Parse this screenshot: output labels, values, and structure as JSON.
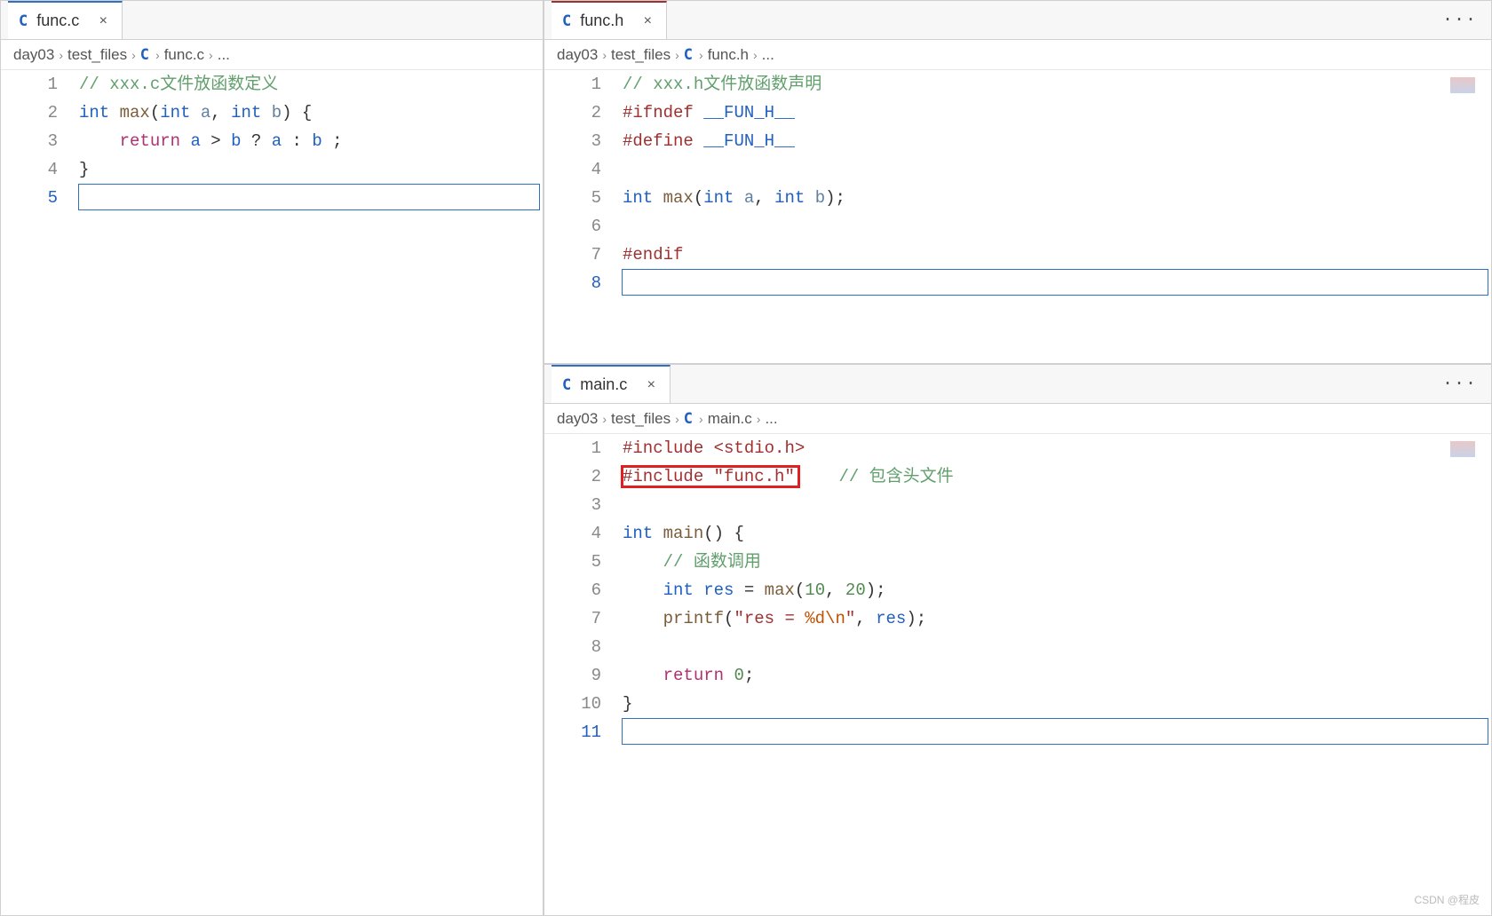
{
  "panes": {
    "top_left": {
      "tab": {
        "icon": "C",
        "name": "func.h",
        "close": "×",
        "more": "···"
      },
      "breadcrumb": [
        "day03",
        "test_files",
        "C",
        "func.h",
        "..."
      ],
      "lines": [
        {
          "n": "1",
          "html": "<span class='c-comment'>// xxx.h文件放函数声明</span>"
        },
        {
          "n": "2",
          "html": "<span class='c-pre'>#ifndef</span> <span class='c-pre-name'>__FUN_H__</span>"
        },
        {
          "n": "3",
          "html": "<span class='c-pre'>#define</span> <span class='c-pre-name'>__FUN_H__</span>"
        },
        {
          "n": "4",
          "html": ""
        },
        {
          "n": "5",
          "html": "<span class='c-type'>int</span> <span class='c-func'>max</span><span class='c-punct'>(</span><span class='c-type'>int</span> <span class='c-param'>a</span><span class='c-punct'>,</span> <span class='c-type'>int</span> <span class='c-param'>b</span><span class='c-punct'>);</span>"
        },
        {
          "n": "6",
          "html": ""
        },
        {
          "n": "7",
          "html": "<span class='c-pre'>#endif</span>"
        },
        {
          "n": "8",
          "html": "",
          "active": true,
          "empty_box": true
        }
      ]
    },
    "right": {
      "tab": {
        "icon": "C",
        "name": "func.c",
        "close": "×"
      },
      "breadcrumb": [
        "day03",
        "test_files",
        "C",
        "func.c",
        "..."
      ],
      "lines": [
        {
          "n": "1",
          "html": "<span class='c-comment'>// xxx.c文件放函数定义</span>"
        },
        {
          "n": "2",
          "html": "<span class='c-type'>int</span> <span class='c-func'>max</span><span class='c-punct'>(</span><span class='c-type'>int</span> <span class='c-param'>a</span><span class='c-punct'>,</span> <span class='c-type'>int</span> <span class='c-param'>b</span><span class='c-punct'>) {</span>"
        },
        {
          "n": "3",
          "html": "    <span class='c-keyword'>return</span> <span class='c-ident'>a</span> <span class='c-punct'>&gt;</span> <span class='c-ident'>b</span> <span class='c-punct'>?</span> <span class='c-ident'>a</span> <span class='c-punct'>:</span> <span class='c-ident'>b</span> <span class='c-punct'>;</span>"
        },
        {
          "n": "4",
          "html": "<span class='c-punct'>}</span>"
        },
        {
          "n": "5",
          "html": "",
          "active": true,
          "empty_box": true
        }
      ]
    },
    "bottom_left": {
      "tab": {
        "icon": "C",
        "name": "main.c",
        "close": "×",
        "more": "···"
      },
      "breadcrumb": [
        "day03",
        "test_files",
        "C",
        "main.c",
        "..."
      ],
      "lines": [
        {
          "n": "1",
          "html": "<span class='c-pre'>#include</span> <span class='c-str'>&lt;stdio.h&gt;</span>"
        },
        {
          "n": "2",
          "html": "<span class='redbox'><span class='c-pre'>#include</span> <span class='c-str'>\"func.h\"</span></span>    <span class='c-comment'>// 包含头文件</span>"
        },
        {
          "n": "3",
          "html": ""
        },
        {
          "n": "4",
          "html": "<span class='c-type'>int</span> <span class='c-func'>main</span><span class='c-punct'>() {</span>"
        },
        {
          "n": "5",
          "html": "    <span class='c-comment'>// 函数调用</span>"
        },
        {
          "n": "6",
          "html": "    <span class='c-type'>int</span> <span class='c-ident'>res</span> <span class='c-punct'>=</span> <span class='c-func'>max</span><span class='c-punct'>(</span><span class='c-num'>10</span><span class='c-punct'>,</span> <span class='c-num'>20</span><span class='c-punct'>);</span>"
        },
        {
          "n": "7",
          "html": "    <span class='c-func'>printf</span><span class='c-punct'>(</span><span class='c-str'>\"res = </span><span class='c-str-esc'>%d\\n</span><span class='c-str'>\"</span><span class='c-punct'>,</span> <span class='c-ident'>res</span><span class='c-punct'>);</span>"
        },
        {
          "n": "8",
          "html": ""
        },
        {
          "n": "9",
          "html": "    <span class='c-keyword'>return</span> <span class='c-num'>0</span><span class='c-punct'>;</span>"
        },
        {
          "n": "10",
          "html": "<span class='c-punct'>}</span>"
        },
        {
          "n": "11",
          "html": "",
          "active": true,
          "empty_box": true
        }
      ]
    }
  },
  "watermark": "CSDN @程皮"
}
